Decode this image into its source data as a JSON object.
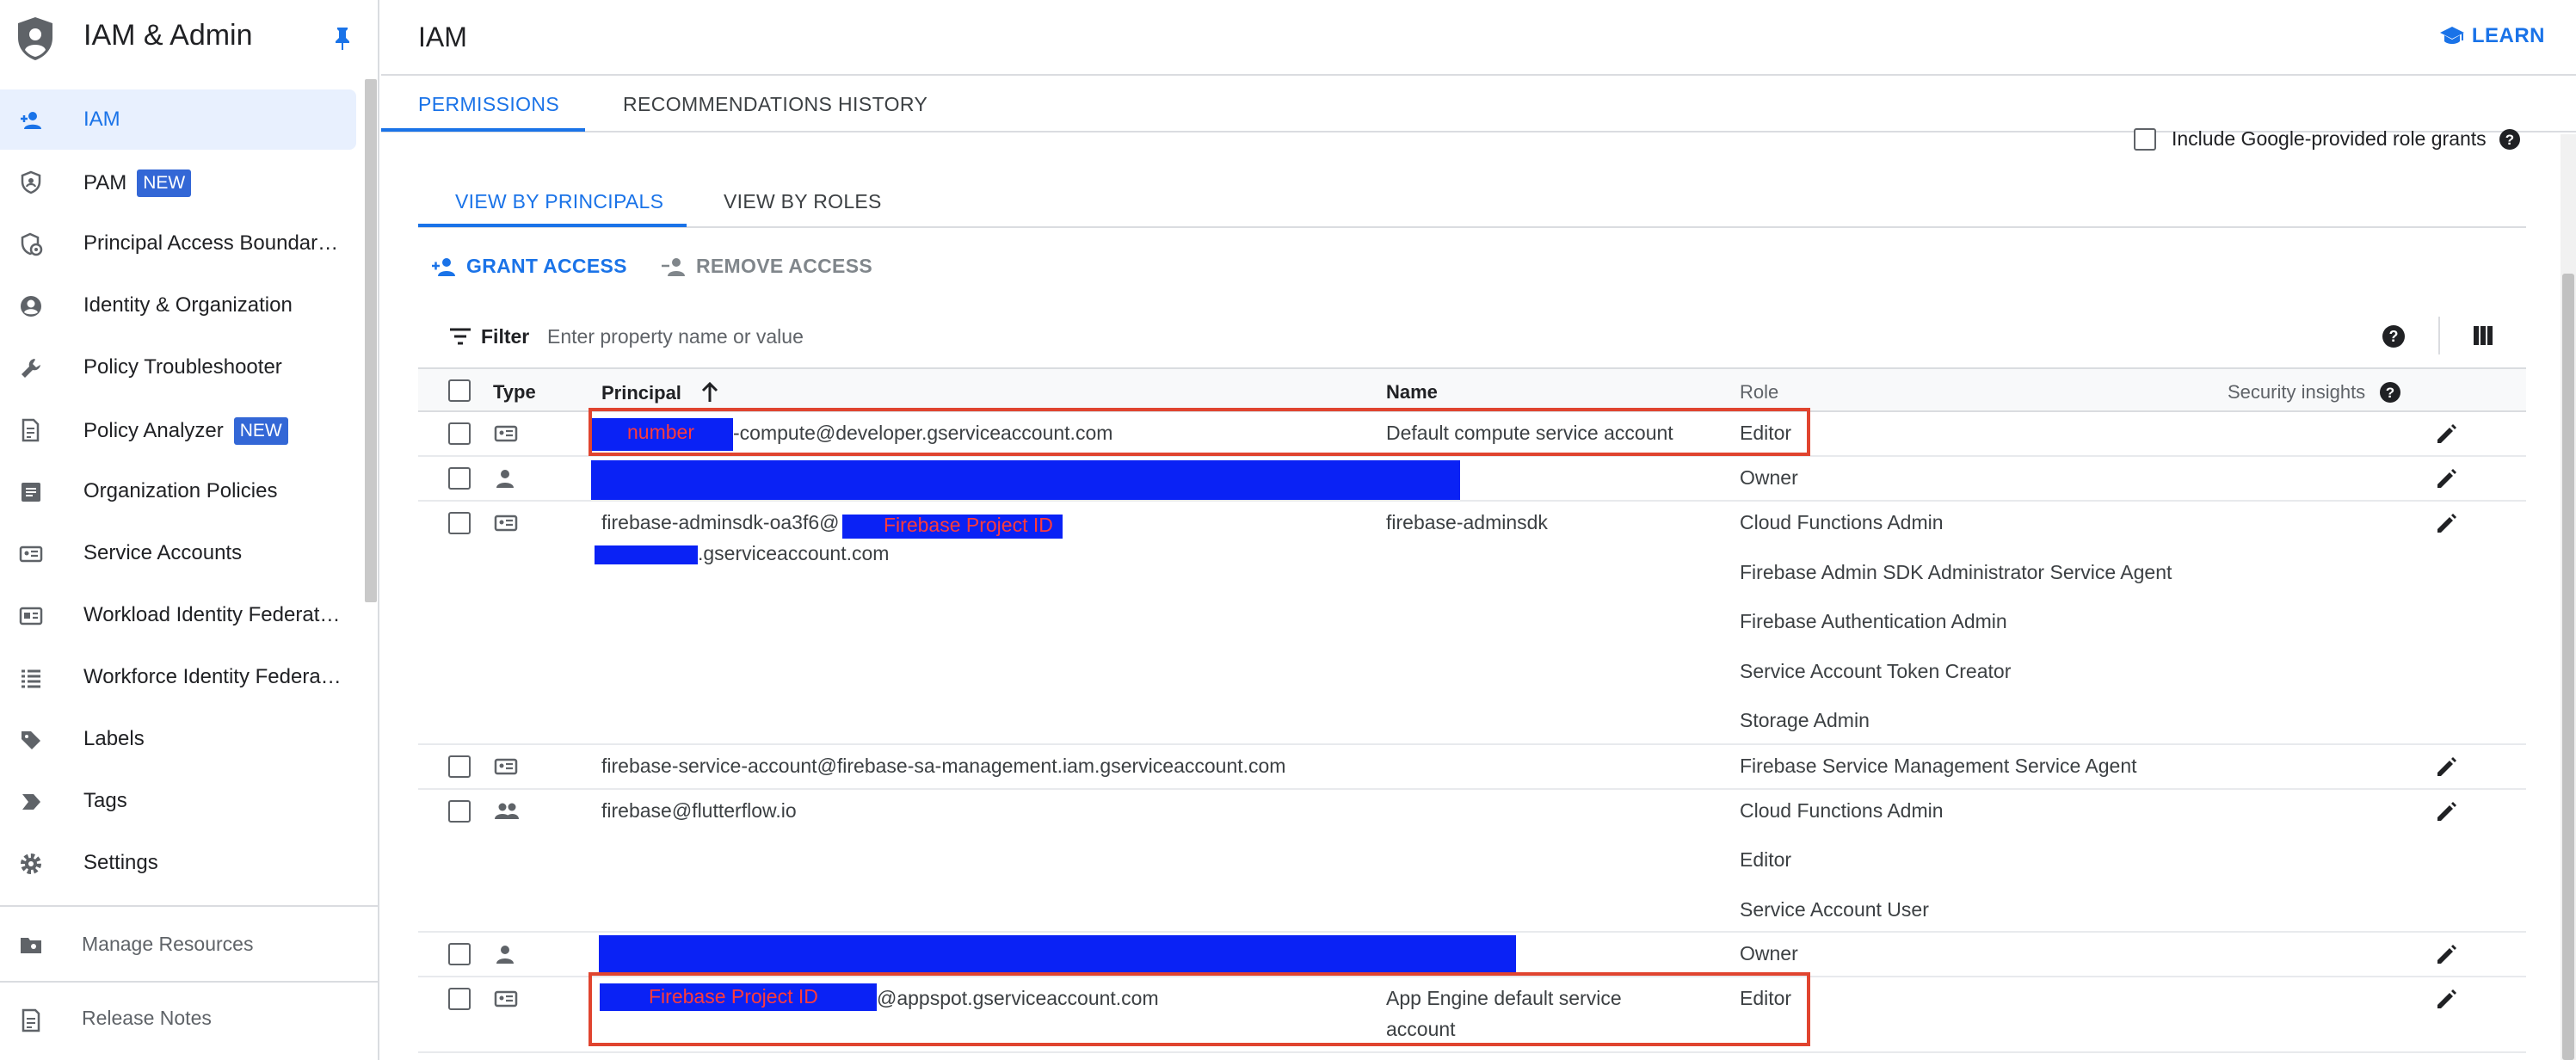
{
  "sidebar": {
    "title": "IAM & Admin",
    "items": [
      {
        "label": "IAM",
        "icon": "person-add-icon",
        "active": true
      },
      {
        "label": "PAM",
        "icon": "shield-icon",
        "badge": "NEW"
      },
      {
        "label": "Principal Access Boundar…",
        "icon": "shield-policy-icon"
      },
      {
        "label": "Identity & Organization",
        "icon": "account-circle-icon"
      },
      {
        "label": "Policy Troubleshooter",
        "icon": "wrench-icon"
      },
      {
        "label": "Policy Analyzer",
        "icon": "policy-document-icon",
        "badge": "NEW"
      },
      {
        "label": "Organization Policies",
        "icon": "article-icon"
      },
      {
        "label": "Service Accounts",
        "icon": "service-account-icon"
      },
      {
        "label": "Workload Identity Federati…",
        "icon": "id-card-icon"
      },
      {
        "label": "Workforce Identity Federa…",
        "icon": "list-icon"
      },
      {
        "label": "Labels",
        "icon": "label-icon"
      },
      {
        "label": "Tags",
        "icon": "tag-icon"
      },
      {
        "label": "Settings",
        "icon": "gear-icon"
      }
    ],
    "manage_resources": "Manage Resources",
    "release_notes": "Release Notes"
  },
  "header": {
    "title": "IAM",
    "learn": "LEARN"
  },
  "tabs": [
    {
      "label": "PERMISSIONS",
      "active": true
    },
    {
      "label": "RECOMMENDATIONS HISTORY"
    }
  ],
  "include_google_grants": "Include Google-provided role grants",
  "view_tabs": [
    {
      "label": "VIEW BY PRINCIPALS",
      "active": true
    },
    {
      "label": "VIEW BY ROLES"
    }
  ],
  "actions": {
    "grant": "GRANT ACCESS",
    "remove": "REMOVE ACCESS"
  },
  "filter": {
    "label": "Filter",
    "placeholder": "Enter property name or value"
  },
  "table": {
    "columns": {
      "type": "Type",
      "principal": "Principal",
      "name": "Name",
      "role": "Role",
      "security": "Security insights"
    },
    "rows": [
      {
        "type": "service-account-icon",
        "principal_redact_label": "number",
        "principal": "-compute@developer.gserviceaccount.com",
        "name": "Default compute service account",
        "roles": [
          "Editor"
        ]
      },
      {
        "type": "person-icon",
        "principal": "",
        "name": "",
        "roles": [
          "Owner"
        ]
      },
      {
        "type": "service-account-icon",
        "principal": "firebase-adminsdk-oa3f6@",
        "principal_redact_label": "Firebase Project ID",
        "principal_line2": ".gserviceaccount.com",
        "name": "firebase-adminsdk",
        "roles": [
          "Cloud Functions Admin",
          "Firebase Admin SDK Administrator Service Agent",
          "Firebase Authentication Admin",
          "Service Account Token Creator",
          "Storage Admin"
        ]
      },
      {
        "type": "service-account-icon",
        "principal": "firebase-service-account@firebase-sa-management.iam.gserviceaccount.com",
        "name": "",
        "roles": [
          "Firebase Service Management Service Agent"
        ]
      },
      {
        "type": "group-icon",
        "principal": "firebase@flutterflow.io",
        "name": "",
        "roles": [
          "Cloud Functions Admin",
          "Editor",
          "Service Account User"
        ]
      },
      {
        "type": "person-icon",
        "principal": "",
        "name": "",
        "roles": [
          "Owner"
        ]
      },
      {
        "type": "service-account-icon",
        "principal_redact_label": "Firebase Project ID",
        "principal": "@appspot.gserviceaccount.com",
        "name_line1": "App Engine default service",
        "name_line2": "account",
        "roles": [
          "Editor"
        ]
      }
    ]
  },
  "colors": {
    "accent": "#1a73e8",
    "redaction": "#0a22f5",
    "callout": "#e0442f",
    "badge": "#3367d6"
  }
}
